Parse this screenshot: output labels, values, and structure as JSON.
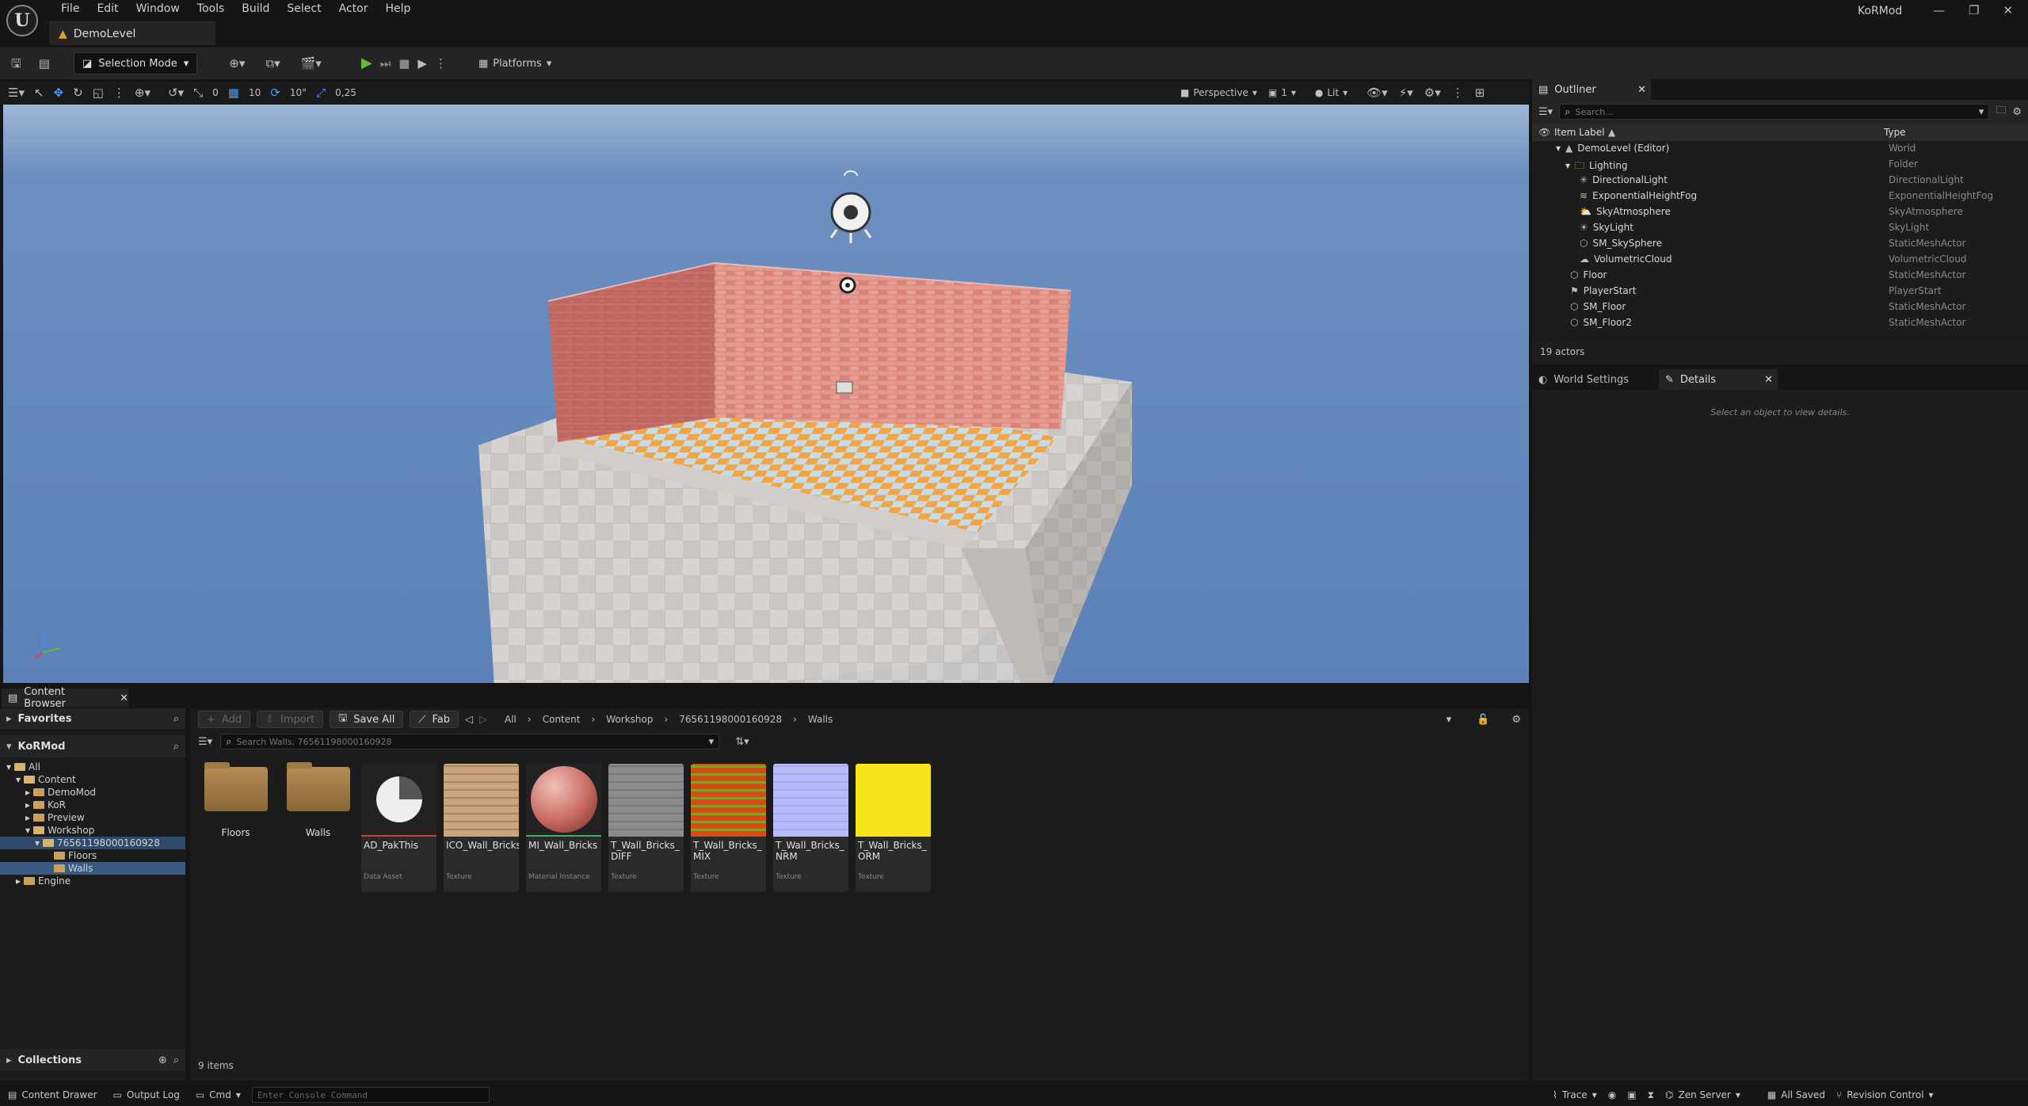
{
  "menu": [
    "File",
    "Edit",
    "Window",
    "Tools",
    "Build",
    "Select",
    "Actor",
    "Help"
  ],
  "level_tab": "DemoLevel",
  "app_title": "KoRMod",
  "toolbar": {
    "selection_mode": "Selection Mode",
    "platforms": "Platforms"
  },
  "viewport_bar": {
    "angle1": "0",
    "grid": "10",
    "rot": "10°",
    "scale": "0,25",
    "perspective": "Perspective",
    "cam": "1",
    "lit": "Lit"
  },
  "content_browser": {
    "tab": "Content Browser",
    "favorites": "Favorites",
    "project": "KoRMod",
    "tree": [
      "All",
      "Content",
      "DemoMod",
      "KoR",
      "Preview",
      "Workshop",
      "76561198000160928",
      "Floors",
      "Walls",
      "Engine"
    ],
    "collections": "Collections",
    "add": "Add",
    "import": "Import",
    "save_all": "Save All",
    "fab": "Fab",
    "breadcrumb": [
      "All",
      "Content",
      "Workshop",
      "76561198000160928",
      "Walls"
    ],
    "search_placeholder": "Search Walls, 76561198000160928",
    "folders": [
      "Floors",
      "Walls"
    ],
    "assets": [
      {
        "name": "AD_PakThis",
        "type": "Data Asset"
      },
      {
        "name": "ICO_Wall_Bricks",
        "type": "Texture"
      },
      {
        "name": "MI_Wall_Bricks",
        "type": "Material Instance"
      },
      {
        "name": "T_Wall_Bricks_\nDIFF",
        "type": "Texture"
      },
      {
        "name": "T_Wall_Bricks_\nMIX",
        "type": "Texture"
      },
      {
        "name": "T_Wall_Bricks_\nNRM",
        "type": "Texture"
      },
      {
        "name": "T_Wall_Bricks_\nORM",
        "type": "Texture"
      }
    ],
    "item_count": "9 items"
  },
  "outliner": {
    "tab": "Outliner",
    "search_placeholder": "Search...",
    "col_label": "Item Label",
    "col_type": "Type",
    "rows": [
      {
        "label": "DemoLevel (Editor)",
        "type": "World",
        "indent": 0
      },
      {
        "label": "Lighting",
        "type": "Folder",
        "indent": 1
      },
      {
        "label": "DirectionalLight",
        "type": "DirectionalLight",
        "indent": 2
      },
      {
        "label": "ExponentialHeightFog",
        "type": "ExponentialHeightFog",
        "indent": 2
      },
      {
        "label": "SkyAtmosphere",
        "type": "SkyAtmosphere",
        "indent": 2
      },
      {
        "label": "SkyLight",
        "type": "SkyLight",
        "indent": 2
      },
      {
        "label": "SM_SkySphere",
        "type": "StaticMeshActor",
        "indent": 2
      },
      {
        "label": "VolumetricCloud",
        "type": "VolumetricCloud",
        "indent": 2
      },
      {
        "label": "Floor",
        "type": "StaticMeshActor",
        "indent": 1
      },
      {
        "label": "PlayerStart",
        "type": "PlayerStart",
        "indent": 1
      },
      {
        "label": "SM_Floor",
        "type": "StaticMeshActor",
        "indent": 1
      },
      {
        "label": "SM_Floor2",
        "type": "StaticMeshActor",
        "indent": 1
      }
    ],
    "actor_count": "19 actors"
  },
  "details": {
    "tab_world": "World Settings",
    "tab_details": "Details",
    "empty": "Select an object to view details."
  },
  "statusbar": {
    "drawer": "Content Drawer",
    "output": "Output Log",
    "cmd": "Cmd",
    "console_placeholder": "Enter Console Command",
    "trace": "Trace",
    "zen": "Zen Server",
    "saved": "All Saved",
    "revision": "Revision Control"
  }
}
